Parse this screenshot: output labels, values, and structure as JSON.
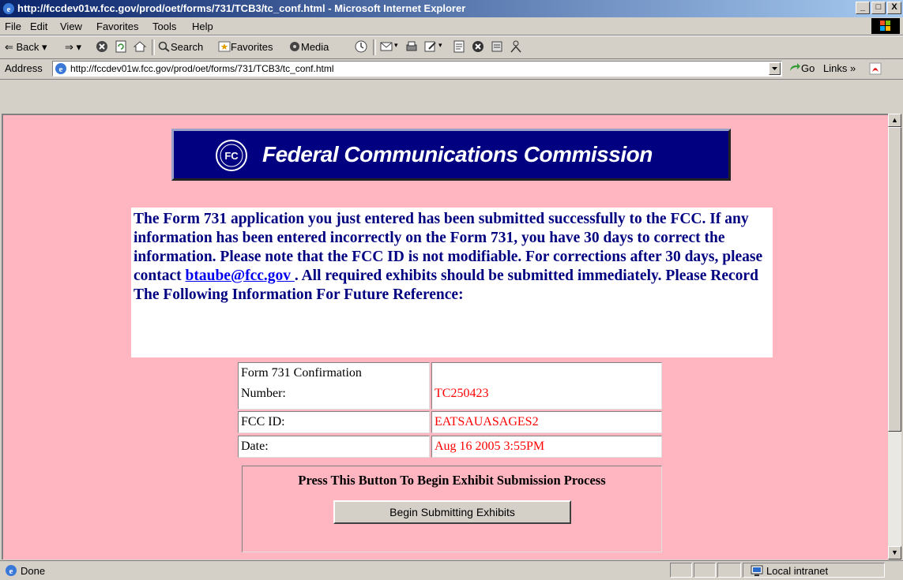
{
  "window": {
    "title": "http://fccdev01w.fcc.gov/prod/oet/forms/731/TCB3/tc_conf.html - Microsoft Internet Explorer",
    "minimize": "_",
    "maximize": "□",
    "close": "X"
  },
  "menu": [
    "File",
    "Edit",
    "View",
    "Favorites",
    "Tools",
    "Help"
  ],
  "toolbar": {
    "back": "Back",
    "search": "Search",
    "favorites": "Favorites",
    "media": "Media"
  },
  "address": {
    "label": "Address",
    "url": "http://fccdev01w.fcc.gov/prod/oet/forms/731/TCB3/tc_conf.html",
    "go": "Go",
    "links": "Links"
  },
  "banner": {
    "seal_text": "FC",
    "title": "Federal Communications Commission"
  },
  "message": {
    "part1": "The Form 731 application you just entered has been submitted successfully to the FCC. If any information has been entered incorrectly on the Form 731, you have 30 days to correct the information. Please note that the FCC ID is not modifiable. For corrections after 30 days, please contact ",
    "email": "btaube@fcc.gov ",
    "part2": ". All required exhibits should be submitted immediately. Please Record The Following Information For Future Reference:"
  },
  "confirmation": {
    "number_label_1": "Form 731 Confirmation",
    "number_label_2": "Number:",
    "number_value": "TC250423",
    "fccid_label": "FCC ID:",
    "fccid_value": "EATSAUASAGES2",
    "date_label": "Date:",
    "date_value": "Aug 16 2005 3:55PM"
  },
  "exhibits": {
    "instruction": "Press This Button To Begin Exhibit Submission Process",
    "button": "Begin Submitting Exhibits"
  },
  "status": {
    "text": "Done",
    "zone": "Local intranet"
  },
  "colors": {
    "page_background": "#ffb6c1",
    "banner_background": "#000080",
    "message_text": "#000080",
    "value_text": "#ff0000"
  }
}
